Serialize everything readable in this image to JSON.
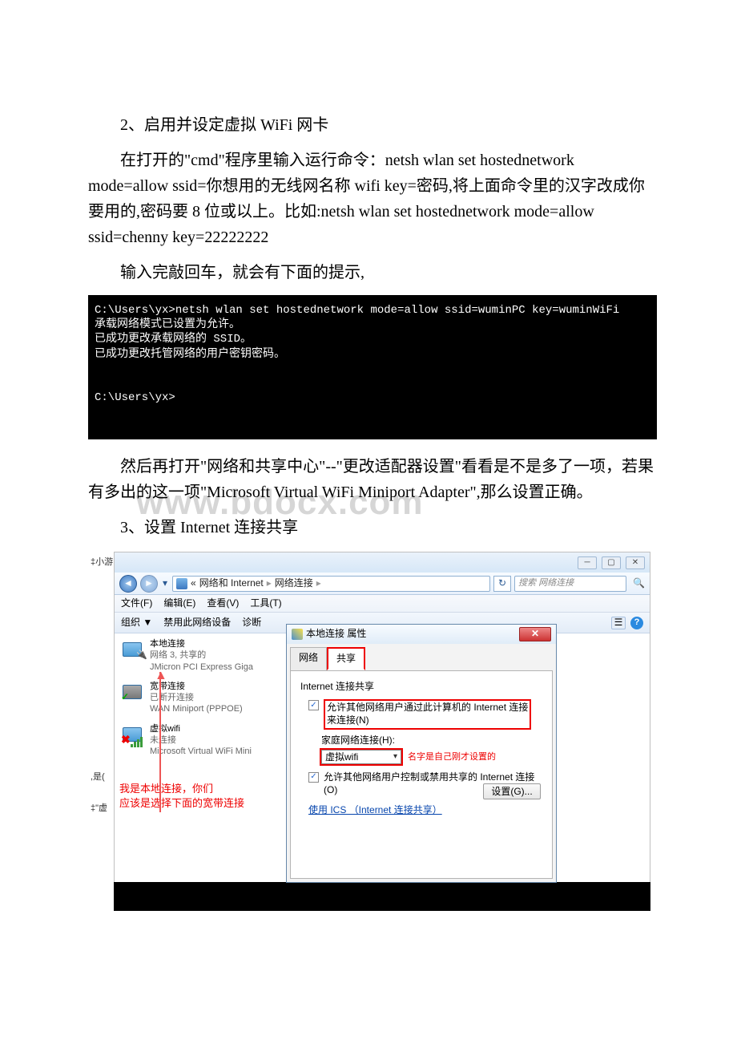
{
  "heading2": "2、启用并设定虚拟 WiFi 网卡",
  "para_cmd_intro": "在打开的\"cmd\"程序里输入运行命令：netsh wlan set hostednetwork mode=allow ssid=你想用的无线网名称 wifi key=密码,将上面命令里的汉字改成你要用的,密码要 8 位或以上。比如:netsh wlan set hostednetwork mode=allow ssid=chenny key=22222222",
  "para_enter": "输入完敲回车，就会有下面的提示,",
  "cmd": {
    "line1": "C:\\Users\\yx>netsh wlan set hostednetwork mode=allow ssid=wuminPC key=wuminWiFi",
    "line2": "承载网络模式已设置为允许。",
    "line3": "已成功更改承载网络的 SSID。",
    "line4": "已成功更改托管网络的用户密钥密码。",
    "line5": "",
    "line6": "",
    "line7": "C:\\Users\\yx>"
  },
  "para_after_cmd": "然后再打开\"网络和共享中心\"--\"更改适配器设置\"看看是不是多了一项，若果有多出的这一项\"Microsoft Virtual WiFi Miniport Adapter\",那么设置正确。",
  "watermark": "www.bdocx.com",
  "heading3": "3、设置 Internet 连接共享",
  "left_clip": {
    "t1": "‡小游",
    "t2": ",是(",
    "t3": "‡\"虚"
  },
  "win": {
    "breadcrumb_prefix": "«",
    "breadcrumb1": "网络和 Internet",
    "breadcrumb2": "网络连接",
    "search_placeholder": "搜索 网络连接",
    "menu_file": "文件(F)",
    "menu_edit": "编辑(E)",
    "menu_view": "查看(V)",
    "menu_tools": "工具(T)",
    "tb_organize": "组织 ▼",
    "tb_disable": "禁用此网络设备",
    "tb_diag": "诊断"
  },
  "adapters": {
    "a1_name": "本地连接",
    "a1_sub": "网络 3, 共享的",
    "a1_dev": "JMicron PCI Express Giga",
    "a2_name": "宽带连接",
    "a2_sub": "已断开连接",
    "a2_dev": "WAN Miniport (PPPOE)",
    "a3_name": "虚拟wifi",
    "a3_sub": "未连接",
    "a3_dev": "Microsoft Virtual WiFi Mini"
  },
  "red_note_line1": "我是本地连接，你们",
  "red_note_line2": "应该是选择下面的宽带连接",
  "dialog": {
    "title": "本地连接 属性",
    "tab_network": "网络",
    "tab_share": "共享",
    "group": "Internet 连接共享",
    "chk1a": "允许其他网络用户通过此计算机的 Internet 连接",
    "chk1b": "来连接(N)",
    "home_label": "家庭网络连接(H):",
    "combo_value": "虚拟wifi",
    "combo_note": "名字是自己刚才设置的",
    "chk2": "允许其他网络用户控制或禁用共享的 Internet 连接(O)",
    "link": "使用 ICS （Internet 连接共享）",
    "btn_settings": "设置(G)..."
  }
}
